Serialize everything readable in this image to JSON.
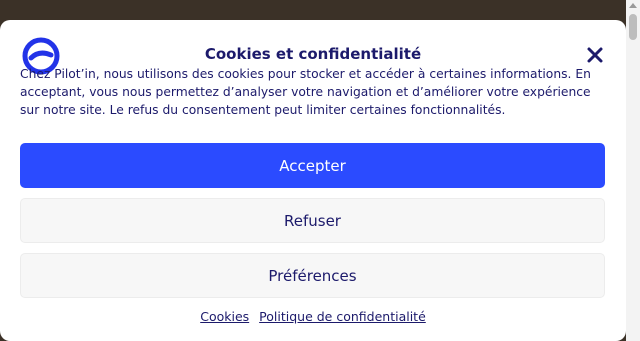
{
  "dialog": {
    "title": "Cookies et confidentialité",
    "body": "Chez Pilot’in, nous utilisons des cookies pour stocker et accéder à certaines informations. En acceptant, vous nous permettez d’analyser votre navigation et d’améliorer votre expérience sur notre site. Le refus du consentement peut limiter certaines fonctionnalités.",
    "accept_label": "Accepter",
    "refuse_label": "Refuser",
    "preferences_label": "Préférences",
    "links": {
      "cookies": "Cookies",
      "privacy": "Politique de confidentialité"
    },
    "close_icon": "close-icon",
    "logo_icon": "brand-logo"
  },
  "colors": {
    "accent": "#2b4bff",
    "text": "#1c1a6b",
    "secondary_button_bg": "#f7f7f7"
  }
}
